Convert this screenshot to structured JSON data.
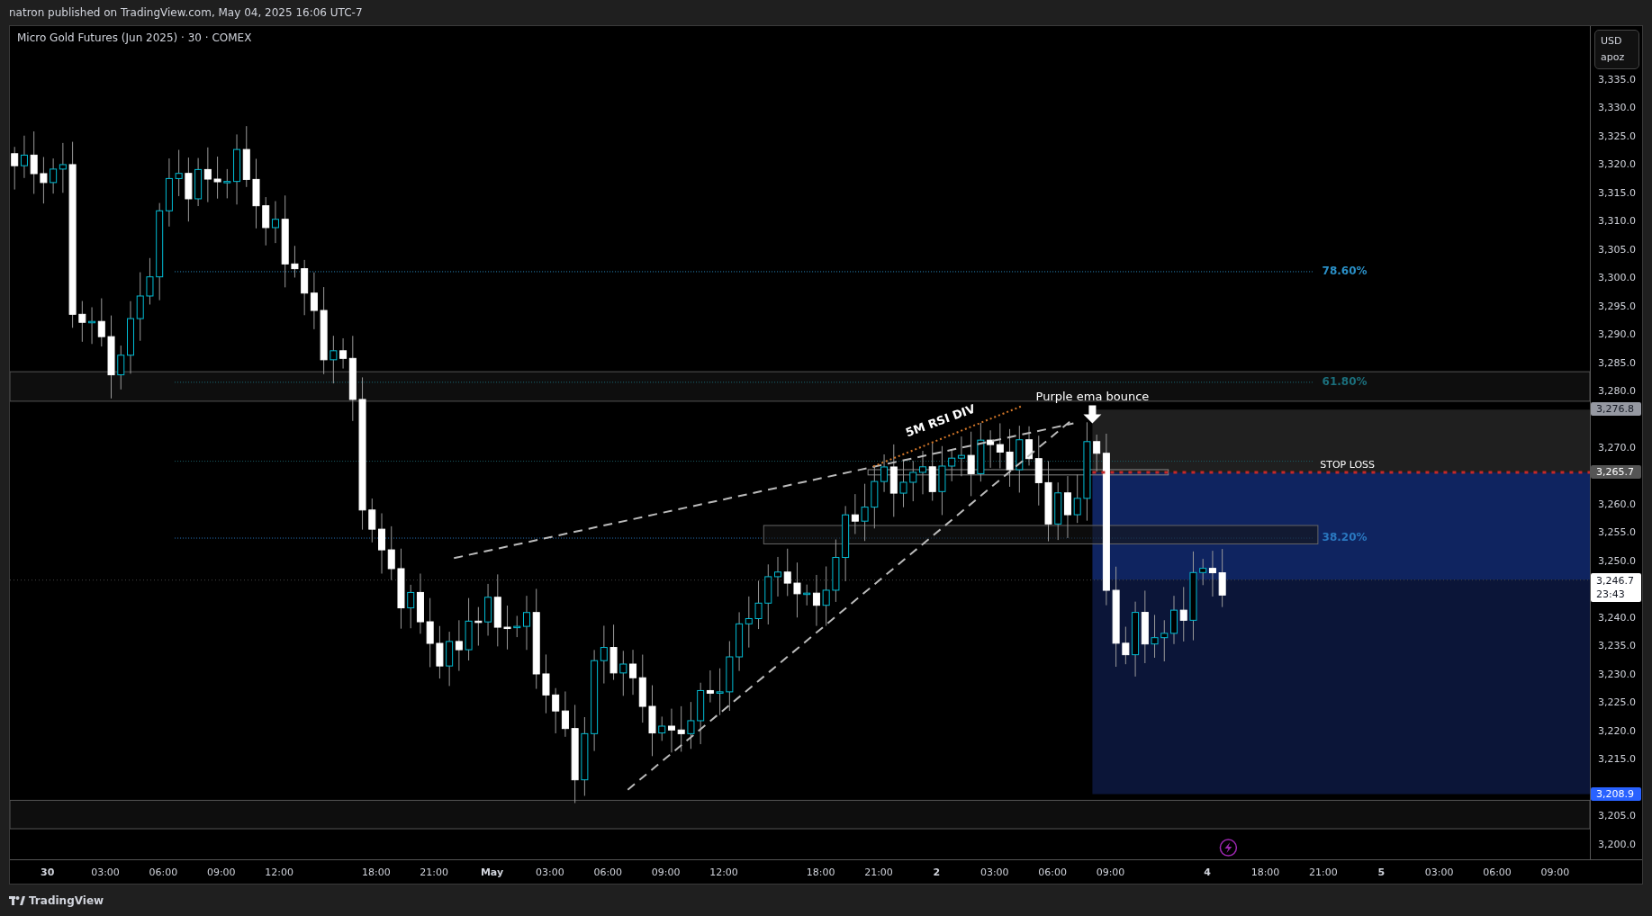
{
  "header": {
    "text": "natron published on TradingView.com, May 04, 2025 16:06 UTC-7"
  },
  "chart": {
    "title": "Micro Gold Futures (Jun 2025) · 30 · COMEX",
    "currency": "USD",
    "unit": "apoz",
    "price_ticks": [
      "3,335.0",
      "3,330.0",
      "3,325.0",
      "3,320.0",
      "3,315.0",
      "3,310.0",
      "3,305.0",
      "3,300.0",
      "3,295.0",
      "3,290.0",
      "3,285.0",
      "3,280.0",
      "3,270.0",
      "3,260.0",
      "3,255.0",
      "3,250.0",
      "3,240.0",
      "3,235.0",
      "3,230.0",
      "3,225.0",
      "3,220.0",
      "3,215.0",
      "3,205.0",
      "3,200.0"
    ],
    "price_badges": [
      {
        "kind": "high",
        "label": "3,276.8"
      },
      {
        "kind": "stop",
        "label": "3,265.7"
      },
      {
        "kind": "last",
        "label": "3,246.7",
        "countdown": "23:43"
      },
      {
        "kind": "target",
        "label": "3,208.9"
      }
    ],
    "fib_levels": [
      {
        "label": "78.60%",
        "color": "#2a8fc6"
      },
      {
        "label": "61.80%",
        "color": "#1b6f7c"
      },
      {
        "label": "38.20%",
        "color": "#2a78c0"
      }
    ],
    "annotations": {
      "stop_loss": "STOP LOSS",
      "note": "Purple ema bounce",
      "divergence": "5M RSI DIV"
    },
    "time_axis": [
      {
        "label": "30",
        "kind": "day"
      },
      {
        "label": "03:00",
        "kind": "time"
      },
      {
        "label": "06:00",
        "kind": "time"
      },
      {
        "label": "09:00",
        "kind": "time"
      },
      {
        "label": "12:00",
        "kind": "time"
      },
      {
        "label": "18:00",
        "kind": "time"
      },
      {
        "label": "21:00",
        "kind": "time"
      },
      {
        "label": "May",
        "kind": "day"
      },
      {
        "label": "03:00",
        "kind": "time"
      },
      {
        "label": "06:00",
        "kind": "time"
      },
      {
        "label": "09:00",
        "kind": "time"
      },
      {
        "label": "12:00",
        "kind": "time"
      },
      {
        "label": "18:00",
        "kind": "time"
      },
      {
        "label": "21:00",
        "kind": "time"
      },
      {
        "label": "2",
        "kind": "day"
      },
      {
        "label": "03:00",
        "kind": "time"
      },
      {
        "label": "06:00",
        "kind": "time"
      },
      {
        "label": "09:00",
        "kind": "time"
      },
      {
        "label": "4",
        "kind": "day"
      },
      {
        "label": "18:00",
        "kind": "time"
      },
      {
        "label": "21:00",
        "kind": "time"
      },
      {
        "label": "5",
        "kind": "day"
      },
      {
        "label": "03:00",
        "kind": "time"
      },
      {
        "label": "06:00",
        "kind": "time"
      },
      {
        "label": "09:00",
        "kind": "time"
      }
    ]
  },
  "footer": {
    "brand": "TradingView"
  }
}
